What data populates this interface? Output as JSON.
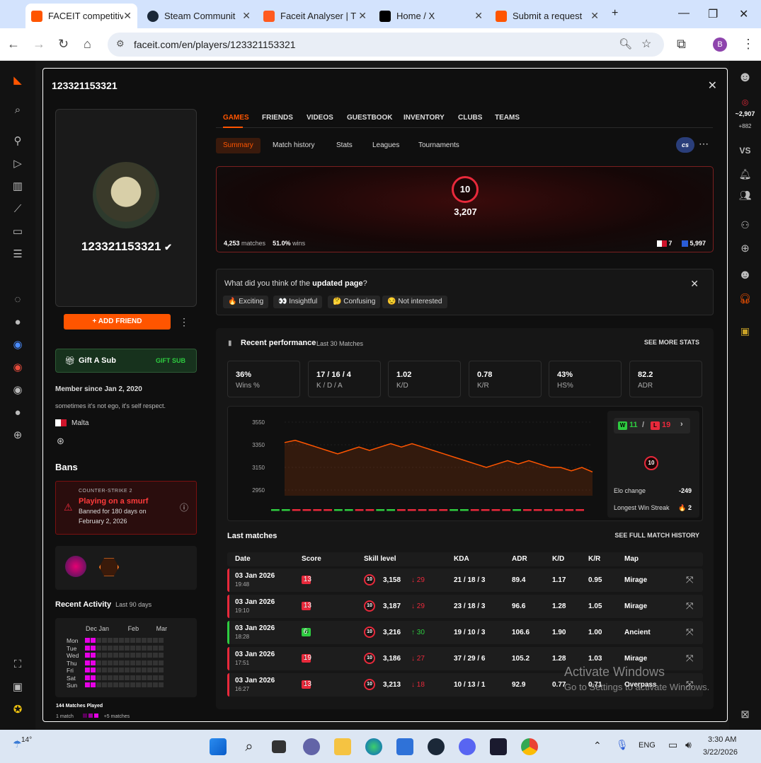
{
  "browser": {
    "tabs": [
      {
        "label": "FACEIT competitive",
        "favicon_color": "#ff5500"
      },
      {
        "label": "Steam Communit",
        "favicon_color": "#1b2838"
      },
      {
        "label": "Faceit Analyser | T",
        "favicon_color": "#ff5a1f"
      },
      {
        "label": "Home / X",
        "favicon_color": "#000000"
      },
      {
        "label": "Submit a request",
        "favicon_color": "#ff5500"
      }
    ],
    "url": "faceit.com/en/players/123321153321",
    "profile_letter": "B"
  },
  "modal": {
    "title": "123321153321",
    "player_name": "123321153321",
    "add_friend": "ADD FRIEND",
    "gift": {
      "label": "Gift A Sub",
      "action": "GIFT SUB"
    },
    "member_since": "Member since Jan 2, 2020",
    "bio": "sometimes it's not ego, it's self respect.",
    "country": "Malta",
    "bans_title": "Bans",
    "ban": {
      "game": "COUNTER-STRIKE 2",
      "reason": "Playing on a smurf",
      "detail1": "Banned for 180 days on",
      "detail2": "February 2, 2026"
    },
    "activity": {
      "title": "Recent Activity",
      "period": "Last 90 days",
      "months": [
        "Dec",
        "Jan",
        "Feb",
        "Mar"
      ],
      "days": [
        "Mon",
        "Tue",
        "Wed",
        "Thu",
        "Fri",
        "Sat",
        "Sun"
      ],
      "matches_played": "144 Matches Played",
      "legend_min": "1 match",
      "legend_max": "+5 matches"
    },
    "game_tabs": [
      "GAMES",
      "FRIENDS",
      "VIDEOS",
      "GUESTBOOK",
      "INVENTORY",
      "CLUBS",
      "TEAMS"
    ],
    "sub_tabs": [
      "Summary",
      "Match history",
      "Stats",
      "Leagues",
      "Tournaments"
    ],
    "hero": {
      "level": "10",
      "elo": "3,207",
      "matches": "4,253",
      "matches_label": "matches",
      "wins": "51.0%",
      "wins_label": "wins",
      "country_rank": "7",
      "region_rank": "5,997"
    },
    "feedback": {
      "question_pre": "What did you think of the ",
      "question_bold": "updated page",
      "question_post": "?",
      "options": [
        "🔥 Exciting",
        "👀 Insightful",
        "🤔 Confusing",
        "😒 Not interested"
      ]
    },
    "performance": {
      "title": "Recent performance",
      "subtitle": "Last 30 Matches",
      "see_more": "SEE MORE STATS",
      "stats": [
        {
          "value": "36%",
          "label": "Wins %"
        },
        {
          "value": "17 / 16 / 4",
          "label": "K / D / A"
        },
        {
          "value": "1.02",
          "label": "K/D"
        },
        {
          "value": "0.78",
          "label": "K/R"
        },
        {
          "value": "43%",
          "label": "HS%"
        },
        {
          "value": "82.2",
          "label": "ADR"
        }
      ],
      "wins": "11",
      "losses": "19",
      "w_label": "W",
      "l_label": "L",
      "elo_change_label": "Elo change",
      "elo_change": "-249",
      "streak_label": "Longest Win Streak",
      "streak": "🔥 2"
    },
    "last_matches": {
      "title": "Last matches",
      "see_full": "SEE FULL MATCH HISTORY",
      "headers": [
        "Date",
        "Score",
        "Skill level",
        "KDA",
        "ADR",
        "K/D",
        "K/R",
        "Map"
      ],
      "rows": [
        {
          "date": "03 Jan 2026",
          "time": "19:48",
          "result": "L",
          "score_a": "9",
          "score_b": "13",
          "elo": "3,158",
          "delta": "↓ 29",
          "kda": "21 / 18 / 3",
          "adr": "89.4",
          "kd": "1.17",
          "kr": "0.95",
          "map": "Mirage"
        },
        {
          "date": "03 Jan 2026",
          "time": "19:10",
          "result": "L",
          "score_a": "9",
          "score_b": "13",
          "elo": "3,187",
          "delta": "↓ 29",
          "kda": "23 / 18 / 3",
          "adr": "96.6",
          "kd": "1.28",
          "kr": "1.05",
          "map": "Mirage"
        },
        {
          "date": "03 Jan 2026",
          "time": "18:28",
          "result": "W",
          "score_a": "13",
          "score_b": "6",
          "elo": "3,216",
          "delta": "↑ 30",
          "kda": "19 / 10 / 3",
          "adr": "106.6",
          "kd": "1.90",
          "kr": "1.00",
          "map": "Ancient"
        },
        {
          "date": "03 Jan 2026",
          "time": "17:51",
          "result": "L",
          "score_a": "17",
          "score_b": "19",
          "elo": "3,186",
          "delta": "↓ 27",
          "kda": "37 / 29 / 6",
          "adr": "105.2",
          "kd": "1.28",
          "kr": "1.03",
          "map": "Mirage"
        },
        {
          "date": "03 Jan 2026",
          "time": "16:27",
          "result": "L",
          "score_a": "1",
          "score_b": "13",
          "elo": "3,213",
          "delta": "↓ 18",
          "kda": "10 / 13 / 1",
          "adr": "92.9",
          "kd": "0.77",
          "kr": "0.71",
          "map": "Overpass"
        }
      ]
    }
  },
  "chart_data": {
    "type": "line",
    "title": "",
    "ylim": [
      2900,
      3600
    ],
    "yticks": [
      "3550",
      "3350",
      "3150",
      "2950"
    ],
    "x": [
      1,
      2,
      3,
      4,
      5,
      6,
      7,
      8,
      9,
      10,
      11,
      12,
      13,
      14,
      15,
      16,
      17,
      18,
      19,
      20,
      21,
      22,
      23,
      24,
      25,
      26,
      27,
      28,
      29,
      30
    ],
    "values": [
      3370,
      3390,
      3360,
      3330,
      3300,
      3270,
      3300,
      3330,
      3300,
      3330,
      3360,
      3330,
      3360,
      3330,
      3300,
      3270,
      3240,
      3210,
      3180,
      3150,
      3180,
      3210,
      3180,
      3210,
      3180,
      3150,
      3150,
      3120,
      3150,
      3110
    ],
    "results": [
      "W",
      "W",
      "L",
      "L",
      "L",
      "L",
      "W",
      "W",
      "L",
      "L",
      "W",
      "W",
      "L",
      "L",
      "L",
      "L",
      "L",
      "W",
      "W",
      "L",
      "L",
      "L",
      "L",
      "W",
      "L",
      "L",
      "L",
      "L",
      "L",
      "L"
    ],
    "line_color": "#ff5500",
    "win_color": "#2ecc40",
    "loss_color": "#e8293b"
  },
  "right_sidebar": {
    "elo": "~2,907",
    "elo_change": "+882",
    "vs": "VS"
  },
  "watermark": {
    "line1": "Activate Windows",
    "line2": "Go to Settings to activate Windows."
  },
  "taskbar": {
    "temp": "14°",
    "lang": "ENG",
    "time": "3:30 AM",
    "date": "3/22/2026"
  }
}
